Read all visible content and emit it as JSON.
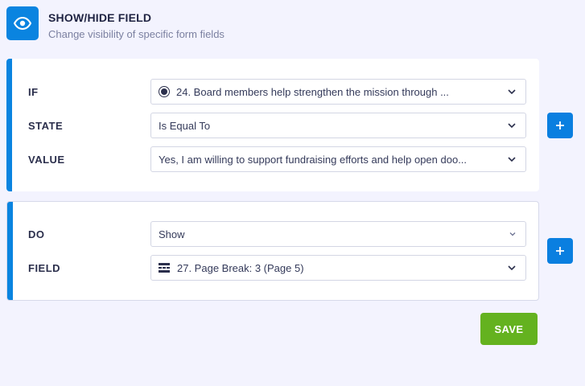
{
  "header": {
    "title": "SHOW/HIDE FIELD",
    "subtitle": "Change visibility of specific form fields"
  },
  "condition": {
    "if_label": "IF",
    "if_value": "24. Board members help strengthen the mission through ...",
    "state_label": "STATE",
    "state_value": "Is Equal To",
    "value_label": "VALUE",
    "value_value": "Yes, I am willing to support fundraising efforts and help open doo..."
  },
  "action": {
    "do_label": "DO",
    "do_value": "Show",
    "field_label": "FIELD",
    "field_value": "27. Page Break: 3 (Page 5)"
  },
  "buttons": {
    "save_label": "SAVE"
  },
  "colors": {
    "accent": "#0a84e0",
    "save": "#64b21f",
    "background": "#f3f3fe"
  },
  "icons": [
    "eye-icon",
    "radio-icon",
    "chevron-down-icon",
    "page-break-icon",
    "plus-icon"
  ]
}
